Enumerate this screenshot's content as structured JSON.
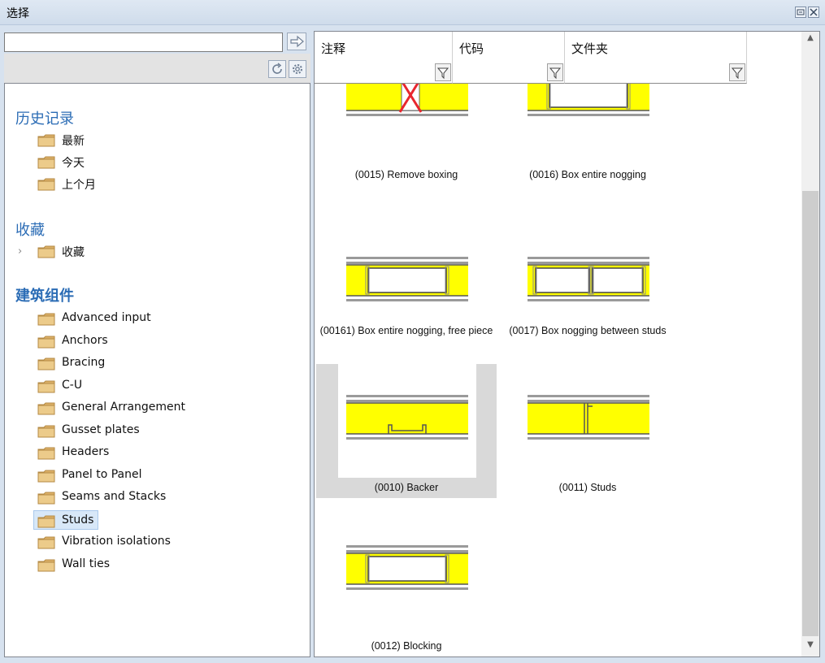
{
  "window": {
    "title": "选择"
  },
  "search": {
    "value": ""
  },
  "tree": {
    "history": {
      "title": "历史记录",
      "items": [
        "最新",
        "今天",
        "上个月"
      ]
    },
    "favorites": {
      "title": "收藏",
      "items": [
        "收藏"
      ]
    },
    "components": {
      "title": "建筑组件",
      "items": [
        "Advanced input",
        "Anchors",
        "Bracing",
        "C-U",
        "General Arrangement",
        "Gusset plates",
        "Headers",
        "Panel to Panel",
        "Seams and Stacks",
        "Studs",
        "Vibration isolations",
        "Wall ties"
      ],
      "selected": "Studs"
    }
  },
  "columns": {
    "note": "注释",
    "code": "代码",
    "folder": "文件夹"
  },
  "gallery": [
    {
      "caption": "(0015) Remove boxing"
    },
    {
      "caption": "(0016) Box entire nogging"
    },
    {
      "caption": "(00161) Box entire nogging, free piece"
    },
    {
      "caption": "(0017) Box nogging between studs"
    },
    {
      "caption": "(0010) Backer"
    },
    {
      "caption": "(0011) Studs"
    },
    {
      "caption": "(0012) Blocking"
    }
  ],
  "colors": {
    "insulation": "#ffff00",
    "link": "#2b6cb5",
    "remove_mark": "#e8262e"
  }
}
